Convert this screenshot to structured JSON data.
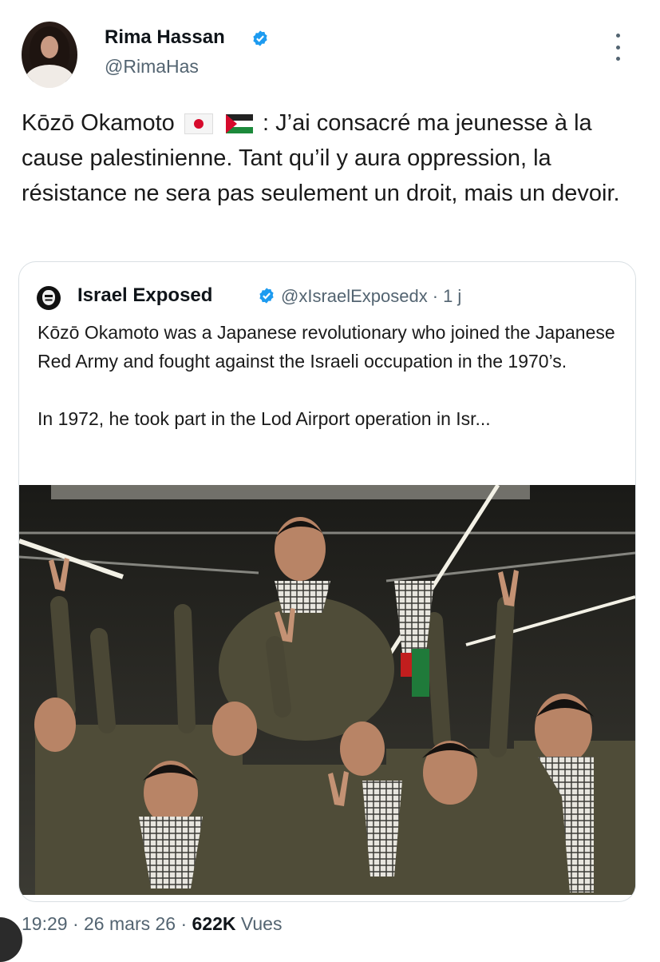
{
  "author": {
    "name": "Rima Hassan",
    "handle": "@RimaHas",
    "verified": true
  },
  "tweet": {
    "text_before_flags": "Kōzō Okamoto",
    "flags": [
      "flag-japan-icon",
      "flag-palestine-icon"
    ],
    "text_after_flags": ": J’ai consacré ma jeunesse à la cause palestinienne. Tant qu’il y aura oppression, la résistance ne sera pas seulement un droit, mais un devoir."
  },
  "quoted_tweet": {
    "name": "Israel Exposed",
    "handle": "@xIsraelExposedx",
    "separator": "·",
    "age": "1 j",
    "verified": true,
    "paragraphs": [
      "Kōzō Okamoto was a Japanese revolutionary who joined the Japanese Red Army and fought against the Israeli occupation in the 1970’s.",
      "In 1972, he took part in the Lod Airport operation in Isr..."
    ],
    "image": "photo of men in olive uniforms raising victory signs, one carried on shoulders"
  },
  "footer": {
    "time": "19:29",
    "dot1": "·",
    "date": "26 mars 26",
    "dot2": "·",
    "views_count": "622K",
    "views_label": "Vues"
  },
  "colors": {
    "text": "#0f1419",
    "secondary": "#536471",
    "verified": "#1d9bf0",
    "border": "#d9dfe3"
  }
}
